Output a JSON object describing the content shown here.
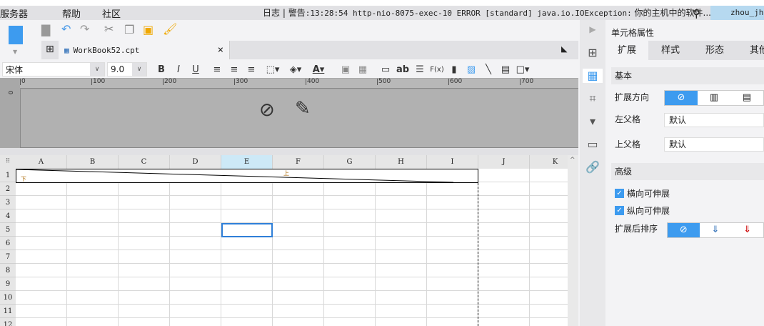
{
  "menu": {
    "items": [
      "服务器",
      "帮助",
      "社区"
    ],
    "log_label": "日志",
    "sep": "|",
    "warn_label": "警告",
    "log_text": ":13:28:54 http-nio-8075-exec-10 ERROR [standard] java.io.IOException:",
    "log_tail": "你的主机中的软件...",
    "user": "zhou_jh"
  },
  "toolbar": {
    "icons": [
      "save-icon",
      "undo-icon",
      "redo-icon",
      "cut-icon",
      "copy-icon",
      "paste-icon",
      "format-painter-icon"
    ]
  },
  "tabs": {
    "file": "WorkBook52.cpt",
    "close": "×"
  },
  "font": {
    "family": "宋体",
    "size": "9.0",
    "bold": "B",
    "italic": "I",
    "underline": "U",
    "text_ab": "ab",
    "fx": "F(x)"
  },
  "ruler": {
    "ticks": [
      "0",
      "100",
      "200",
      "300",
      "400",
      "500",
      "600",
      "700"
    ],
    "vtick": "0"
  },
  "grid": {
    "columns": [
      "A",
      "B",
      "C",
      "D",
      "E",
      "F",
      "G",
      "H",
      "I",
      "J",
      "K"
    ],
    "rows": [
      "1",
      "2",
      "3",
      "4",
      "5",
      "6",
      "7",
      "8",
      "9",
      "10",
      "11",
      "12"
    ],
    "selected_col": "E",
    "selected_row": "5",
    "slash_top": "上",
    "slash_bottom": "下"
  },
  "panel": {
    "title": "单元格属性",
    "tabs": [
      "扩展",
      "样式",
      "形态",
      "其他"
    ],
    "basic": "基本",
    "expand_dir": "扩展方向",
    "left_parent": "左父格",
    "left_parent_value": "默认",
    "top_parent": "上父格",
    "top_parent_value": "默认",
    "advanced": "高级",
    "h_expand": "横向可伸展",
    "v_expand": "纵向可伸展",
    "sort_after": "扩展后排序"
  },
  "colors": {
    "accent": "#3d9bef",
    "user_bg": "#b6d9f0",
    "selection": "#2f7fd8"
  }
}
